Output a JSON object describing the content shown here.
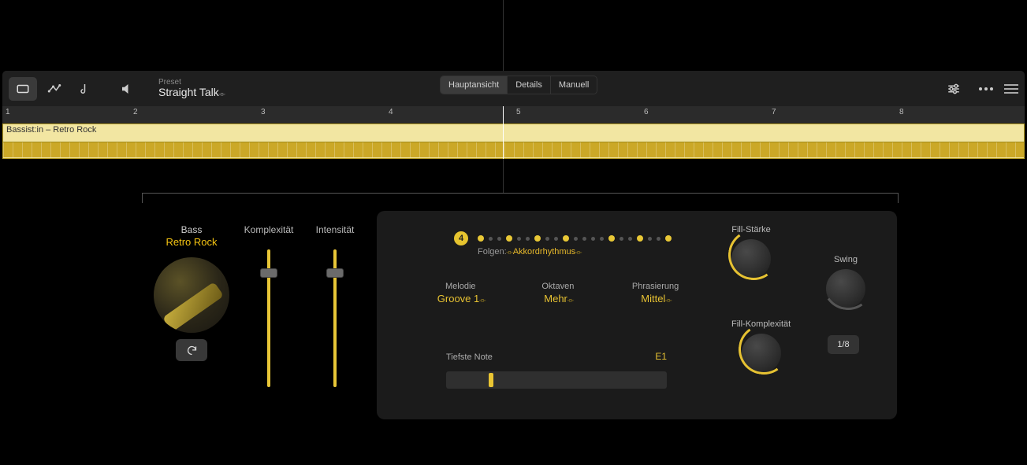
{
  "header": {
    "preset_label": "Preset",
    "preset_name": "Straight Talk",
    "views": {
      "main": "Hauptansicht",
      "details": "Details",
      "manual": "Manuell"
    }
  },
  "ruler": {
    "marks": [
      1,
      2,
      3,
      4,
      5,
      6,
      7,
      8
    ]
  },
  "region": {
    "name": "Bassist:in – Retro Rock"
  },
  "instrument": {
    "type_label": "Bass",
    "style": "Retro Rock"
  },
  "sliders": {
    "complexity_label": "Komplexität",
    "intensity_label": "Intensität"
  },
  "steps": {
    "current": "4",
    "follow_label": "Folgen:",
    "follow_value": "Akkordrhythmus"
  },
  "params": {
    "melody_label": "Melodie",
    "melody_value": "Groove 1",
    "octaves_label": "Oktaven",
    "octaves_value": "Mehr",
    "phrasing_label": "Phrasierung",
    "phrasing_value": "Mittel"
  },
  "low_note": {
    "label": "Tiefste Note",
    "value": "E1"
  },
  "knobs": {
    "fill_strength": "Fill-Stärke",
    "fill_complexity": "Fill-Komplexität",
    "swing": "Swing",
    "swing_div": "1/8"
  }
}
